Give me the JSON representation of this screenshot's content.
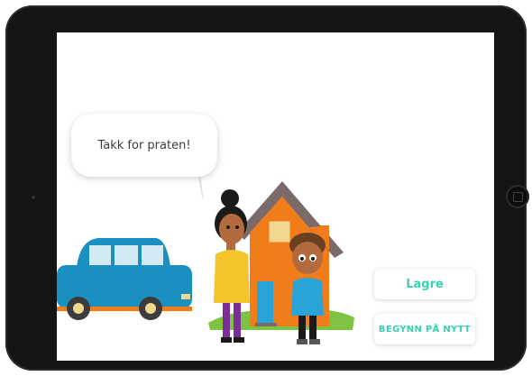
{
  "speech_bubble": {
    "text": "Takk for praten!"
  },
  "buttons": {
    "save_label": "Lagre",
    "restart_label": "BEGYNN PÅ NYTT"
  },
  "colors": {
    "accent": "#37d0b3",
    "car": "#1a8fc0",
    "house": "#f07d1a",
    "roof": "#7a6a6a",
    "grass": "#7dc242"
  }
}
